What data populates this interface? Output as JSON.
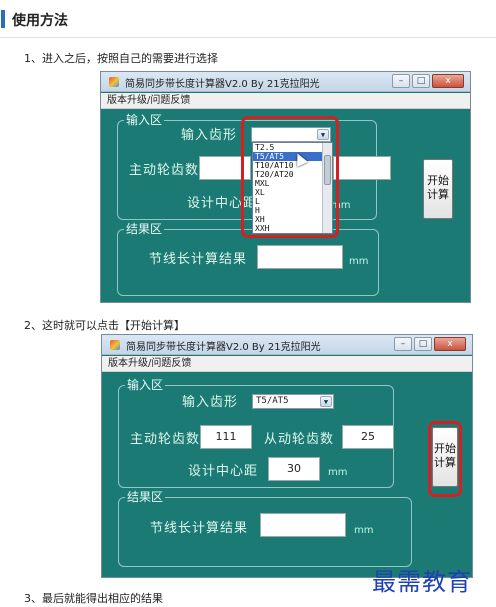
{
  "page": {
    "title": "使用方法",
    "step1": "1、进入之后，按照自己的需要进行选择",
    "step2": "2、这时就可以点击【开始计算】",
    "step3": "3、最后就能得出相应的结果",
    "watermark": "最需教育"
  },
  "app": {
    "caption": "简易同步带长度计算器V2.0  By 21克拉阳光",
    "menu": "版本升级/问题反馈",
    "input_group": "输入区",
    "result_group": "结果区",
    "tooth_label": "输入齿形",
    "driving_label": "主动轮齿数",
    "driven_label": "从动轮齿数",
    "center_label": "设计中心距",
    "result_label": "节线长计算结果",
    "unit": "mm",
    "calc_button": "开始计算",
    "min_btn": "–",
    "max_btn": "□",
    "close_btn": "x"
  },
  "screenshot1": {
    "combo_value": "",
    "dropdown_options": [
      "T2.5",
      "T5/AT5",
      "T10/AT10",
      "T20/AT20",
      "MXL",
      "XL",
      "L",
      "H",
      "XH",
      "XXH"
    ],
    "selected_option": "T5/AT5",
    "cut_label": "设计中心距",
    "cut_unit": "mm"
  },
  "screenshot2": {
    "combo_value": "T5/AT5",
    "driving_value": "111",
    "driven_value": "25",
    "center_value": "30"
  },
  "colors": {
    "window_bg": "#1b7a73",
    "highlight": "#d42020",
    "accent": "#2a6fb7"
  }
}
